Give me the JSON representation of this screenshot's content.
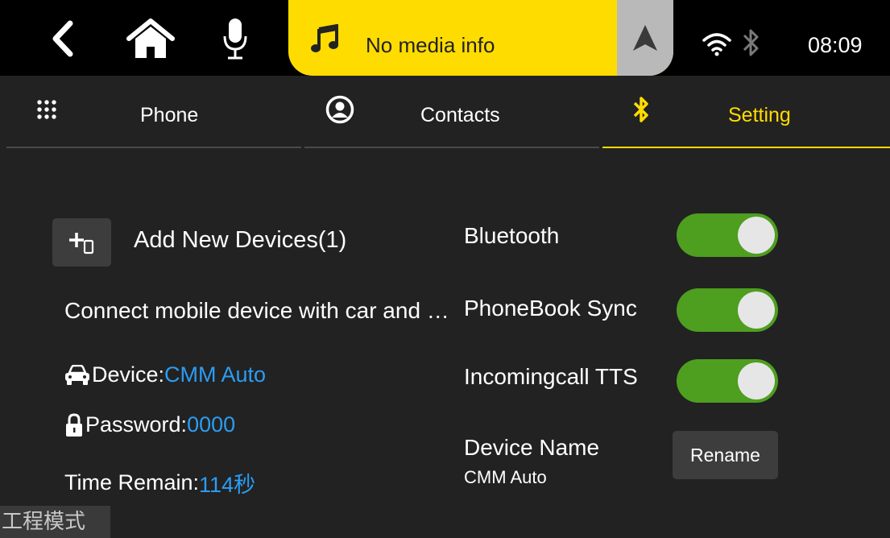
{
  "status_bar": {
    "media_text": "No media info",
    "time": "08:09",
    "icons": [
      "back-icon",
      "home-icon",
      "microphone-icon",
      "music-note-icon",
      "navigation-arrow-icon",
      "wifi-icon",
      "bluetooth-icon"
    ]
  },
  "tabs": [
    {
      "label": "Phone",
      "icon": "dialpad-icon",
      "active": false
    },
    {
      "label": "Contacts",
      "icon": "contacts-icon",
      "active": false
    },
    {
      "label": "Setting",
      "icon": "bluetooth-icon",
      "active": true
    }
  ],
  "devices": {
    "add_label": "Add New Devices(1)",
    "connect_text": "Connect mobile device with car and enjoy music",
    "device_label": "Device: ",
    "device_value": "CMM Auto",
    "password_label": "Password: ",
    "password_value": "0000",
    "time_label": "Time Remain: ",
    "time_value": "114秒"
  },
  "settings": {
    "bluetooth_label": "Bluetooth",
    "bluetooth_on": true,
    "phonebook_label": "PhoneBook Sync",
    "phonebook_on": true,
    "tts_label": "Incomingcall TTS",
    "tts_on": true,
    "device_name_label": "Device Name",
    "device_name_value": "CMM Auto",
    "rename_label": "Rename"
  },
  "engineering_mode": "工程模式",
  "colors": {
    "accent": "#ffdc00",
    "link": "#2b9df4",
    "toggle_on": "#4e9e1f",
    "background": "#222222",
    "statusbar": "#000000"
  }
}
